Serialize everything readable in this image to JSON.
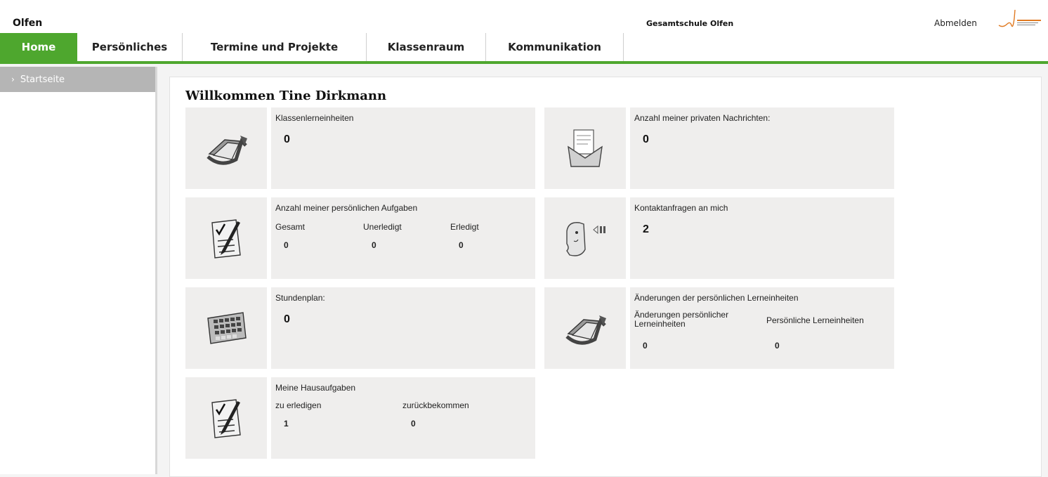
{
  "header": {
    "brand": "Olfen",
    "school": "Gesamtschule Olfen",
    "logout": "Abmelden"
  },
  "nav": {
    "tabs": [
      {
        "label": "Home",
        "active": true
      },
      {
        "label": "Persönliches",
        "active": false
      },
      {
        "label": "Termine und Projekte",
        "active": false
      },
      {
        "label": "Klassenraum",
        "active": false
      },
      {
        "label": "Kommunikation",
        "active": false
      }
    ]
  },
  "sidebar": {
    "items": [
      {
        "label": "Startseite"
      }
    ]
  },
  "main": {
    "welcome": "Willkommen Tine Dirkmann",
    "tiles": {
      "klassen": {
        "title": "Klassenlerneinheiten",
        "value": "0",
        "icon": "folder-arrow-icon"
      },
      "nachrichten": {
        "title": "Anzahl meiner privaten Nachrichten:",
        "value": "0",
        "icon": "envelope-icon"
      },
      "aufgaben": {
        "title": "Anzahl meiner persönlichen Aufgaben",
        "cols": [
          {
            "label": "Gesamt",
            "value": "0"
          },
          {
            "label": "Unerledigt",
            "value": "0"
          },
          {
            "label": "Erledigt",
            "value": "0"
          }
        ],
        "icon": "checklist-icon"
      },
      "kontakt": {
        "title": "Kontaktanfragen an mich",
        "value": "2",
        "icon": "contact-head-icon"
      },
      "stundenplan": {
        "title": "Stundenplan:",
        "value": "0",
        "icon": "calendar-icon"
      },
      "aenderungen": {
        "title": "Änderungen der persönlichen Lerneinheiten",
        "cols": [
          {
            "label": "Änderungen persönlicher Lerneinheiten",
            "value": "0"
          },
          {
            "label": "Persönliche Lerneinheiten",
            "value": "0"
          }
        ],
        "icon": "folder-arrow-icon"
      },
      "hausaufgaben": {
        "title": "Meine Hausaufgaben",
        "cols": [
          {
            "label": "zu erledigen",
            "value": "1"
          },
          {
            "label": "zurückbekommen",
            "value": "0"
          }
        ],
        "icon": "checklist-icon"
      }
    }
  },
  "colors": {
    "accent": "#4ea72e",
    "tile": "#efeeed",
    "sidebar_active": "#b5b5b5"
  }
}
